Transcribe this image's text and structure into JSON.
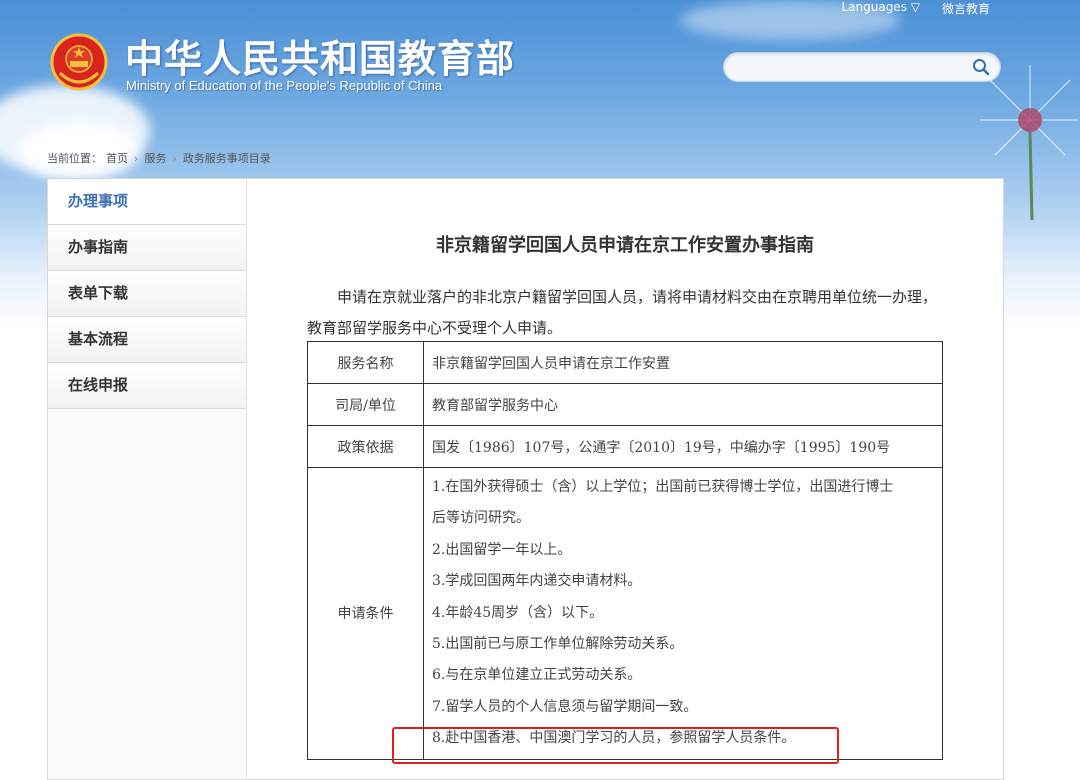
{
  "header": {
    "title_cn": "中华人民共和国教育部",
    "title_en": "Ministry of Education of the People's Republic of China",
    "top_links": [
      "Languages ▽",
      "微言教育"
    ]
  },
  "search": {
    "placeholder": ""
  },
  "breadcrumb": {
    "prefix": "当前位置：",
    "items": [
      "首页",
      "服务",
      "政务服务事项目录"
    ]
  },
  "sidebar": {
    "items": [
      {
        "label": "办理事项",
        "active": true
      },
      {
        "label": "办事指南",
        "active": false
      },
      {
        "label": "表单下载",
        "active": false
      },
      {
        "label": "基本流程",
        "active": false
      },
      {
        "label": "在线申报",
        "active": false
      }
    ]
  },
  "main": {
    "title": "非京籍留学回国人员申请在京工作安置办事指南",
    "intro": "申请在京就业落户的非北京户籍留学回国人员，请将申请材料交由在京聘用单位统一办理，教育部留学服务中心不受理个人申请。",
    "table": {
      "rows": [
        {
          "label": "服务名称",
          "value": "非京籍留学回国人员申请在京工作安置"
        },
        {
          "label": "司局/单位",
          "value": "教育部留学服务中心"
        },
        {
          "label": "政策依据",
          "value": "国发〔1986〕107号，公通字〔2010〕19号，中编办字〔1995〕190号"
        }
      ],
      "conditions": {
        "label": "申请条件",
        "lines": [
          "1.在国外获得硕士（含）以上学位；出国前已获得博士学位，出国进行博士",
          "后等访问研究。",
          "2.出国留学一年以上。",
          "3.学成回国两年内递交申请材料。",
          "4.年龄45周岁（含）以下。",
          "5.出国前已与原工作单位解除劳动关系。",
          "6.与在京单位建立正式劳动关系。",
          "7.留学人员的个人信息须与留学期间一致。",
          "8.赴中国香港、中国澳门学习的人员，参照留学人员条件。"
        ]
      }
    }
  },
  "colors": {
    "highlight": "#e0201d",
    "active_nav": "#3c6fb6",
    "sky": "#4b8fd6"
  }
}
